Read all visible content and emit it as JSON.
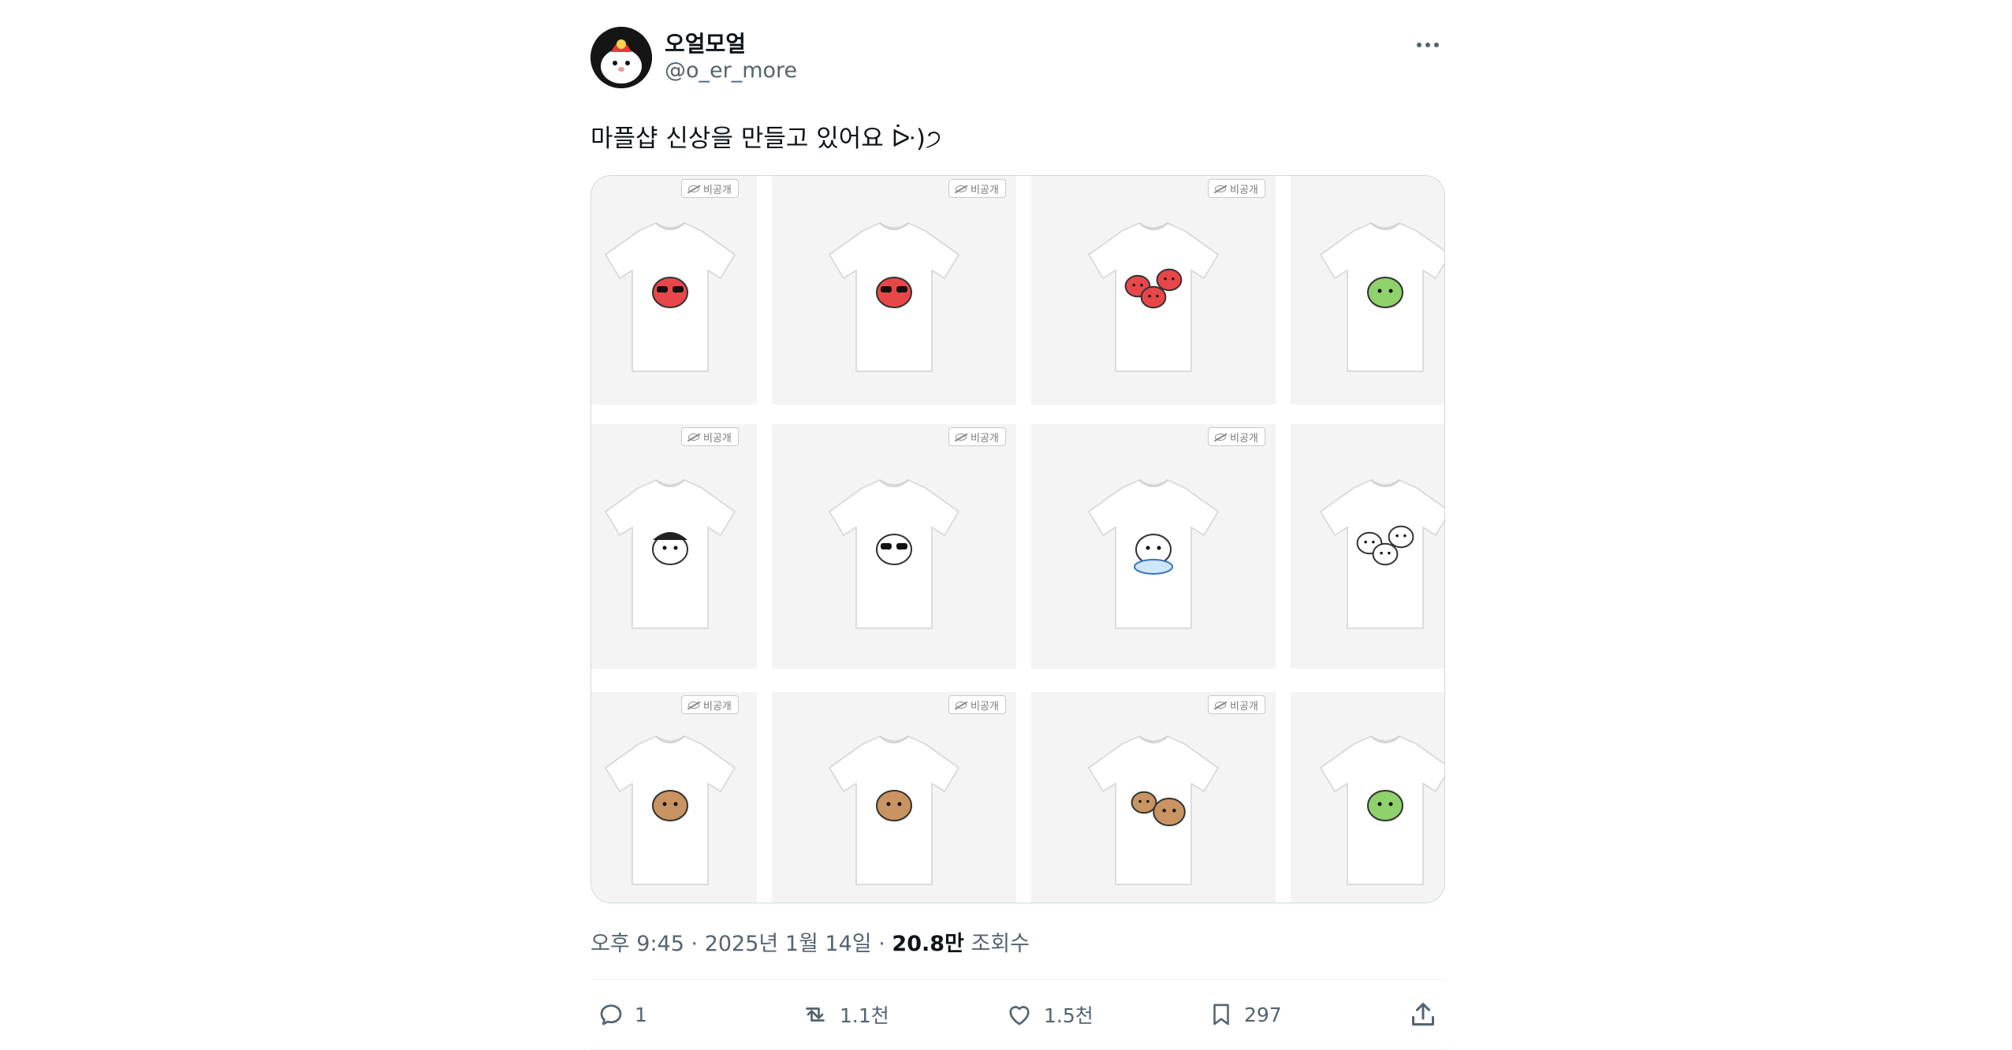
{
  "author": {
    "display_name": "오얼모얼",
    "handle": "@o_er_more"
  },
  "tweet": {
    "text": "마플샵 신상을 만들고 있어요 ᐕ)੭"
  },
  "media": {
    "badge_label": "비공개",
    "designs": [
      [
        "strawberry-sunglasses",
        "strawberry-sunglasses",
        "strawberry-trio",
        "frog-hood"
      ],
      [
        "penguin-hat",
        "penguin-sunglasses",
        "hamster-drums",
        "band-trio"
      ],
      [
        "monkey",
        "monkey",
        "monkey-duo",
        "frog"
      ]
    ]
  },
  "meta": {
    "time": "오후 9:45",
    "date": "2025년 1월 14일",
    "views_count": "20.8만",
    "views_label": "조회수",
    "separator": "·"
  },
  "actions": {
    "reply_count": "1",
    "retweet_count": "1.1천",
    "like_count": "1.5천",
    "bookmark_count": "297"
  },
  "colors": {
    "text_primary": "#0f1419",
    "text_secondary": "#536471",
    "border": "#cfd9de",
    "tile_bg": "#f4f4f4"
  }
}
